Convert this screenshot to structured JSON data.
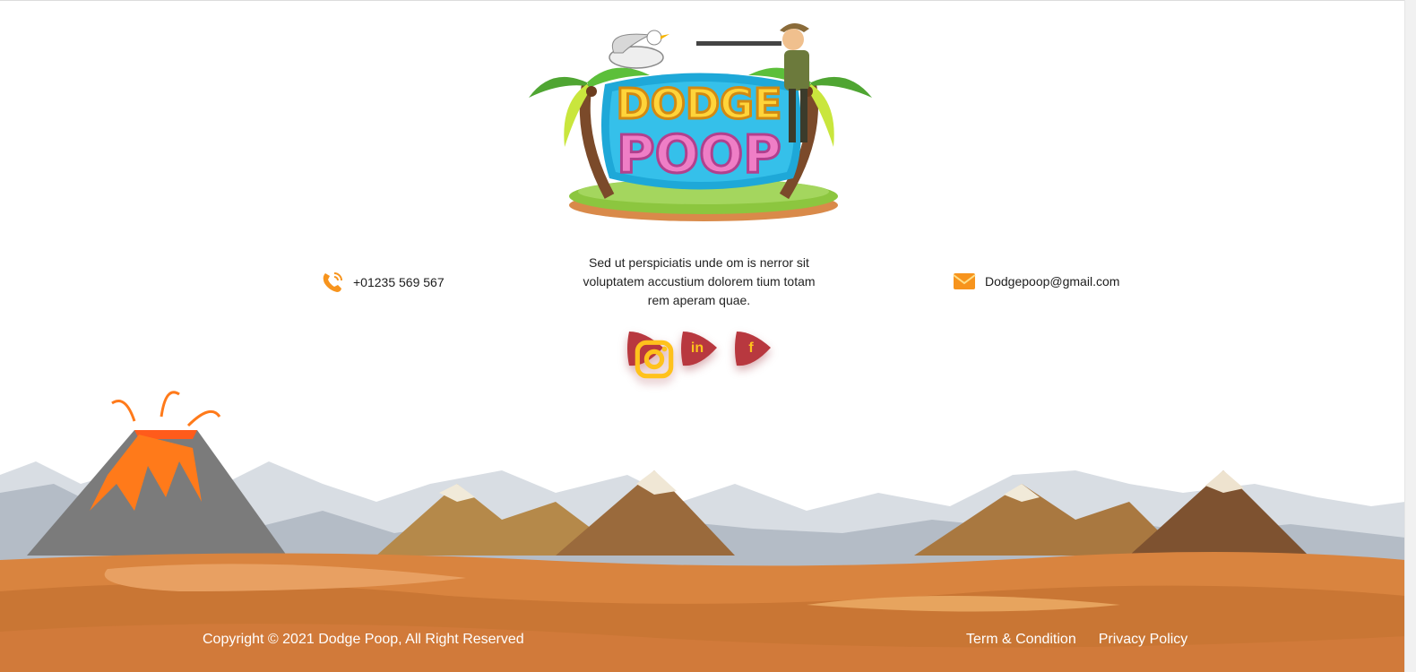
{
  "brand": {
    "logo_line1": "DODGE",
    "logo_line2": "POOP"
  },
  "contact": {
    "phone_icon": "phone-icon",
    "phone": "+01235 569 567",
    "email_icon": "email-icon",
    "email": "Dodgepoop@gmail.com"
  },
  "about": {
    "text": "Sed ut perspiciatis unde om is nerror sit voluptatem accustium dolorem tium totam rem aperam quae."
  },
  "social": [
    {
      "name": "instagram",
      "icon": "instagram-icon"
    },
    {
      "name": "linkedin",
      "icon": "linkedin-icon",
      "glyph": "in"
    },
    {
      "name": "facebook",
      "icon": "facebook-icon",
      "glyph": "f"
    }
  ],
  "footer": {
    "copyright": "Copyright © 2021 Dodge Poop, All Right Reserved",
    "links": [
      "Term & Condition",
      "Privacy Policy"
    ]
  },
  "colors": {
    "social_bg": "#b8383f",
    "social_glyph": "#ffc21c",
    "ground": "#d9843f",
    "footer_text": "#ffffff"
  }
}
